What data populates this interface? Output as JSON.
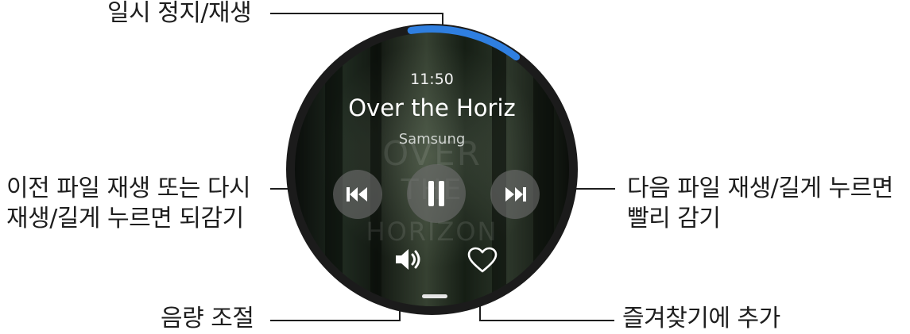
{
  "watch": {
    "time": "11:50",
    "track_title": "Over the Horiz",
    "artist": "Samsung",
    "album_art_words": [
      "OVER",
      "THE",
      "HORIZON"
    ]
  },
  "callouts": {
    "play_pause": "일시 정지/재생",
    "previous": [
      "이전 파일 재생 또는 다시",
      "재생/길게 누르면 되감기"
    ],
    "next": [
      "다음 파일 재생/길게 누르면",
      "빨리 감기"
    ],
    "volume": "음량 조절",
    "favorite": "즐겨찾기에 추가"
  },
  "icons": {
    "previous": "skip-previous-icon",
    "play_pause": "pause-icon",
    "next": "skip-next-icon",
    "volume": "volume-icon",
    "favorite": "heart-icon"
  },
  "colors": {
    "progress_accent": "#2f7fe0",
    "callout_line": "#1e1e1e"
  },
  "playback_progress": 0.18
}
